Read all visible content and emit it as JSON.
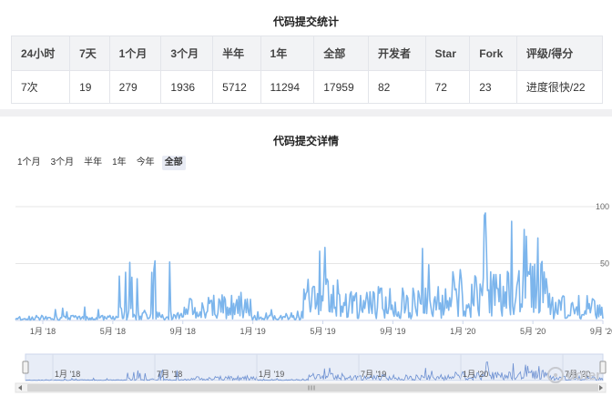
{
  "stats": {
    "title": "代码提交统计",
    "headers": [
      "24小时",
      "7天",
      "1个月",
      "3个月",
      "半年",
      "1年",
      "全部",
      "开发者",
      "Star",
      "Fork",
      "评级/得分"
    ],
    "values": [
      "7次",
      "19",
      "279",
      "1936",
      "5712",
      "11294",
      "17959",
      "82",
      "72",
      "23",
      "进度很快/22"
    ]
  },
  "detail": {
    "title": "代码提交详情",
    "range_tabs": [
      "1个月",
      "3个月",
      "半年",
      "1年",
      "今年",
      "全部"
    ],
    "active_tab": "全部"
  },
  "watermark": "doter",
  "chart_data": {
    "type": "bar",
    "title": "代码提交详情",
    "x_ticks": [
      "1月 '18",
      "5月 '18",
      "9月 '18",
      "1月 '19",
      "5月 '19",
      "9月 '19",
      "1月 '20",
      "5月 '20",
      "9月 '20"
    ],
    "y_ticks": [
      50,
      100
    ],
    "ylim": [
      0,
      120
    ],
    "x_range": [
      "2017-10",
      "2020-09"
    ],
    "series_color": "#7cb5ec",
    "grid": true,
    "navigator_ticks": [
      "1月 '18",
      "7月 '18",
      "1月 '19",
      "7月 '19",
      "1月 '20",
      "7月 '20"
    ],
    "segments": [
      {
        "period": "2017-10 to 2018-04",
        "typical": 3,
        "max": 12
      },
      {
        "period": "2018-04 to 2018-06",
        "typical": 8,
        "max": 55
      },
      {
        "period": "2018-06 to 2018-08",
        "typical": 5,
        "max": 58
      },
      {
        "period": "2018-08 to 2018-12",
        "typical": 15,
        "max": 35
      },
      {
        "period": "2018-12 to 2019-03",
        "typical": 3,
        "max": 10
      },
      {
        "period": "2019-03 to 2019-06",
        "typical": 25,
        "max": 75
      },
      {
        "period": "2019-06 to 2019-12",
        "typical": 20,
        "max": 85
      },
      {
        "period": "2019-12 to 2020-03",
        "typical": 30,
        "max": 105
      },
      {
        "period": "2020-03 to 2020-06",
        "typical": 35,
        "max": 110
      },
      {
        "period": "2020-06 to 2020-09",
        "typical": 15,
        "max": 55
      }
    ]
  }
}
